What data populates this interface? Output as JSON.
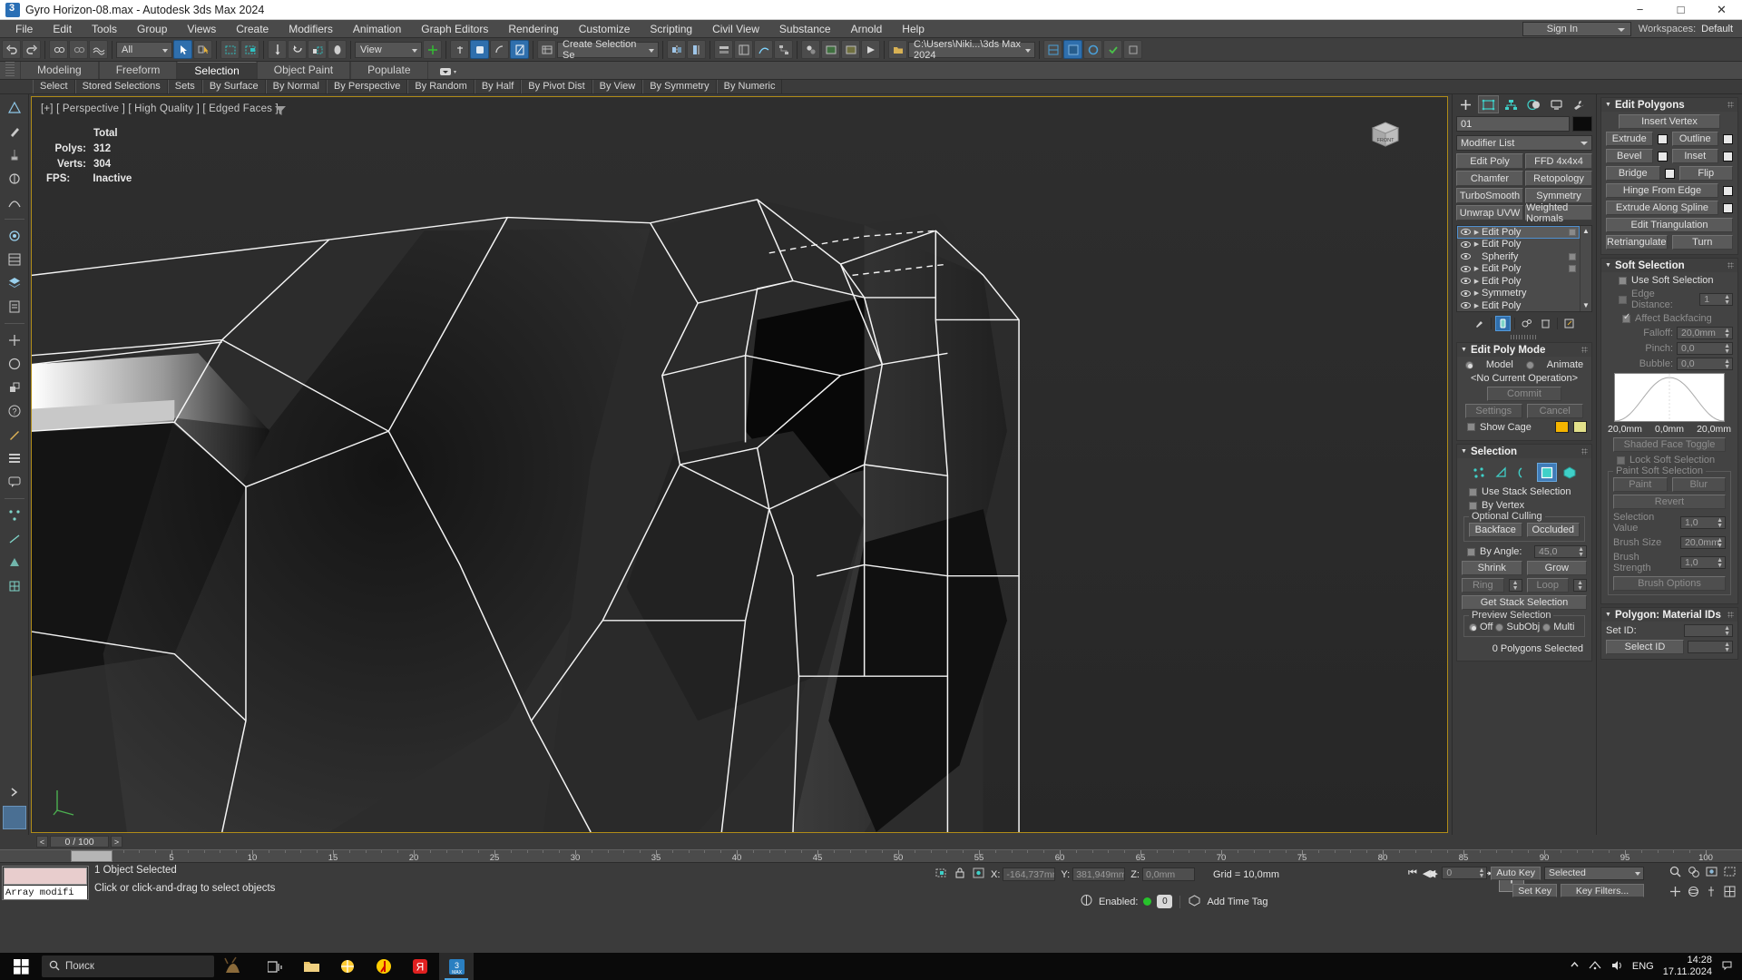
{
  "window": {
    "title": "Gyro Horizon-08.max - Autodesk 3ds Max 2024",
    "app_icon": "3dsmax-icon",
    "minimize": "−",
    "maximize": "□",
    "close": "✕"
  },
  "menu": {
    "items": [
      "File",
      "Edit",
      "Tools",
      "Group",
      "Views",
      "Create",
      "Modifiers",
      "Animation",
      "Graph Editors",
      "Rendering",
      "Customize",
      "Scripting",
      "Civil View",
      "Substance",
      "Arnold",
      "Help"
    ],
    "sign_in": "Sign In",
    "workspaces_label": "Workspaces:",
    "workspaces_value": "Default"
  },
  "toolbar": {
    "selection_filter": "All",
    "view_combo": "View",
    "selection_set": "Create Selection Se",
    "project_path": "C:\\Users\\Niki...\\3ds Max 2024"
  },
  "ribbon": {
    "tabs": [
      "Modeling",
      "Freeform",
      "Selection",
      "Object Paint",
      "Populate"
    ],
    "active_tab": "Selection",
    "sub_buttons": [
      "Select",
      "Stored Selections",
      "Sets",
      "By Surface",
      "By Normal",
      "By Perspective",
      "By Random",
      "By Half",
      "By Pivot Dist",
      "By View",
      "By Symmetry",
      "By Numeric"
    ]
  },
  "viewport": {
    "label": "[+] [ Perspective ] [ High Quality ] [ Edged Faces ]",
    "stats_header": "Total",
    "stats": [
      {
        "key": "Polys:",
        "value": "312"
      },
      {
        "key": "Verts:",
        "value": "304"
      }
    ],
    "fps_key": "FPS:",
    "fps_value": "Inactive",
    "border_color": "#b08c18"
  },
  "command_panel": {
    "tabs": [
      "create-tab",
      "modify-tab",
      "hierarchy-tab",
      "motion-tab",
      "display-tab",
      "utilities-tab"
    ],
    "active_tab_index": 1,
    "object_name": "01",
    "object_color": "#0b0b0b",
    "modifier_list": "Modifier List",
    "modifier_buttons": [
      "Edit Poly",
      "FFD 4x4x4",
      "Chamfer",
      "Retopology",
      "TurboSmooth",
      "Symmetry",
      "Unwrap UVW",
      "Weighted Normals"
    ],
    "stack": [
      {
        "name": "Edit Poly",
        "selected": true,
        "has_arrow": true,
        "has_box": true
      },
      {
        "name": "Edit Poly",
        "selected": false,
        "has_arrow": true,
        "has_box": false
      },
      {
        "name": "Spherify",
        "selected": false,
        "has_arrow": false,
        "has_box": true
      },
      {
        "name": "Edit Poly",
        "selected": false,
        "has_arrow": true,
        "has_box": true
      },
      {
        "name": "Edit Poly",
        "selected": false,
        "has_arrow": true,
        "has_box": false
      },
      {
        "name": "Symmetry",
        "selected": false,
        "has_arrow": true,
        "has_box": false
      },
      {
        "name": "Edit Poly",
        "selected": false,
        "has_arrow": true,
        "has_box": false
      }
    ],
    "stack_tools": [
      "pin-stack-icon",
      "show-end-result-icon",
      "make-unique-icon",
      "remove-modifier-icon",
      "configure-modifier-sets-icon"
    ]
  },
  "edit_poly_mode": {
    "title": "Edit Poly Mode",
    "model_label": "Model",
    "animate_label": "Animate",
    "model_selected": true,
    "current_operation": "<No Current Operation>",
    "commit": "Commit",
    "settings": "Settings",
    "cancel": "Cancel",
    "show_cage": "Show Cage",
    "cage_color_1": "#f4b400",
    "cage_color_2": "#e2e08a"
  },
  "selection_rollout": {
    "title": "Selection",
    "sub_object_icons": [
      "vertex-icon",
      "edge-icon",
      "border-icon",
      "polygon-icon",
      "element-icon"
    ],
    "active_sub_object": 3,
    "use_stack_selection": "Use Stack Selection",
    "by_vertex": "By Vertex",
    "optional_culling_title": "Optional Culling",
    "backface": "Backface",
    "occluded": "Occluded",
    "by_angle": "By Angle:",
    "by_angle_value": "45,0",
    "shrink": "Shrink",
    "grow": "Grow",
    "ring": "Ring",
    "loop": "Loop",
    "get_stack_selection": "Get Stack Selection",
    "preview_selection_title": "Preview Selection",
    "preview_off": "Off",
    "preview_subobj": "SubObj",
    "preview_multi": "Multi",
    "status": "0 Polygons Selected"
  },
  "edit_polygons": {
    "title": "Edit Polygons",
    "insert_vertex": "Insert Vertex",
    "extrude": "Extrude",
    "outline": "Outline",
    "bevel": "Bevel",
    "inset": "Inset",
    "bridge": "Bridge",
    "flip": "Flip",
    "hinge_from_edge": "Hinge From Edge",
    "extrude_along_spline": "Extrude Along Spline",
    "edit_triangulation": "Edit Triangulation",
    "retriangulate": "Retriangulate",
    "turn": "Turn"
  },
  "soft_selection": {
    "title": "Soft Selection",
    "use_soft_selection": "Use Soft Selection",
    "edge_distance": "Edge Distance:",
    "edge_distance_value": "1",
    "affect_backfacing": "Affect Backfacing",
    "falloff": "Falloff:",
    "falloff_value": "20,0mm",
    "pinch": "Pinch:",
    "pinch_value": "0,0",
    "bubble": "Bubble:",
    "bubble_value": "0,0",
    "curve_labels": [
      "20,0mm",
      "0,0mm",
      "20,0mm"
    ],
    "shaded_face_toggle": "Shaded Face Toggle",
    "lock_soft_selection": "Lock Soft Selection",
    "paint_soft_selection_title": "Paint Soft Selection",
    "paint": "Paint",
    "blur": "Blur",
    "revert": "Revert",
    "selection_value": "Selection Value",
    "selection_value_num": "1,0",
    "brush_size": "Brush Size",
    "brush_size_num": "20,0mm",
    "brush_strength": "Brush Strength",
    "brush_strength_num": "1,0",
    "brush_options": "Brush Options"
  },
  "polygon_material_ids": {
    "title": "Polygon: Material IDs",
    "set_id": "Set ID:",
    "select_id": "Select ID"
  },
  "timeline": {
    "prev_btn": "<",
    "frame_display": "0 / 100",
    "next_btn": ">",
    "ticks": [
      0,
      5,
      10,
      15,
      20,
      25,
      30,
      35,
      40,
      45,
      50,
      55,
      60,
      65,
      70,
      75,
      80,
      85,
      90,
      95,
      100
    ],
    "current_frame": 0,
    "total_frames": 100
  },
  "status_bar": {
    "maxscript_mini_listener": "Array modifi",
    "message_1": "1 Object Selected",
    "message_2": "Click or click-and-drag to select objects",
    "coord_x_label": "X:",
    "coord_x_value": "-164,737mm",
    "coord_y_label": "Y:",
    "coord_y_value": "381,949mm",
    "coord_z_label": "Z:",
    "coord_z_value": "0,0mm",
    "grid": "Grid = 10,0mm",
    "enabled_label": "Enabled:",
    "enabled_count": "0",
    "add_time_tag": "Add Time Tag",
    "auto_key": "Auto Key",
    "set_key": "Set Key",
    "key_filters": "Key Filters...",
    "key_mode": "Selected",
    "key_frame_value": "0"
  },
  "taskbar": {
    "search_placeholder": "Поиск",
    "apps": [
      "task-view-icon",
      "file-explorer-icon",
      "paint-icon",
      "yandex-browser-icon",
      "yandex-icon",
      "3dsmax-icon"
    ],
    "active_app_index": 5,
    "language": "ENG",
    "time": "14:28",
    "date": "17.11.2024"
  }
}
